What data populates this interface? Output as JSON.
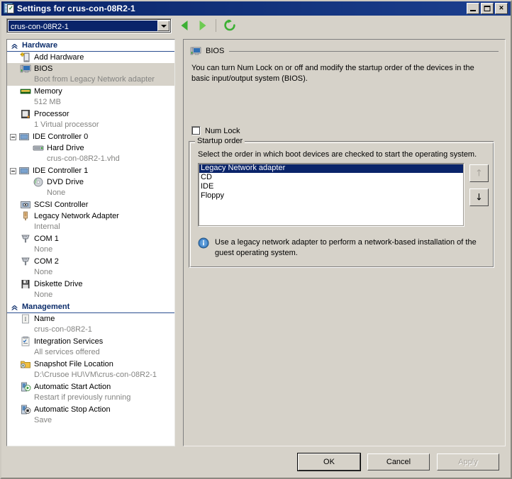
{
  "window": {
    "title": "Settings for crus-con-08R2-1",
    "title_icon": "settings-document-icon",
    "minimize_label": "",
    "maximize_label": "",
    "close_label": "×"
  },
  "toolbar": {
    "vm_selector_value": "crus-con-08R2-1",
    "back_icon": "back-arrow-icon",
    "forward_icon": "forward-arrow-icon",
    "refresh_icon": "refresh-icon"
  },
  "sidebar": {
    "groups": [
      {
        "title": "Hardware",
        "collapse_icon": "chevron-double-up-icon",
        "items": [
          {
            "label": "Add Hardware",
            "sub": "",
            "icon": "add-hardware-icon",
            "indent": 0,
            "expander": false,
            "selected": false
          },
          {
            "label": "BIOS",
            "sub": "Boot from Legacy Network adapter",
            "icon": "bios-icon",
            "indent": 0,
            "expander": false,
            "selected": true
          },
          {
            "label": "Memory",
            "sub": "512 MB",
            "icon": "memory-icon",
            "indent": 0,
            "expander": false,
            "selected": false
          },
          {
            "label": "Processor",
            "sub": "1 Virtual processor",
            "icon": "processor-icon",
            "indent": 0,
            "expander": false,
            "selected": false
          },
          {
            "label": "IDE Controller 0",
            "sub": "",
            "icon": "ide-controller-icon",
            "indent": 0,
            "expander": true,
            "selected": false
          },
          {
            "label": "Hard Drive",
            "sub": "crus-con-08R2-1.vhd",
            "icon": "hard-drive-icon",
            "indent": 1,
            "expander": false,
            "selected": false
          },
          {
            "label": "IDE Controller 1",
            "sub": "",
            "icon": "ide-controller-icon",
            "indent": 0,
            "expander": true,
            "selected": false
          },
          {
            "label": "DVD Drive",
            "sub": "None",
            "icon": "dvd-drive-icon",
            "indent": 1,
            "expander": false,
            "selected": false
          },
          {
            "label": "SCSI Controller",
            "sub": "",
            "icon": "scsi-controller-icon",
            "indent": 0,
            "expander": false,
            "selected": false
          },
          {
            "label": "Legacy Network Adapter",
            "sub": "Internal",
            "icon": "network-adapter-icon",
            "indent": 0,
            "expander": false,
            "selected": false
          },
          {
            "label": "COM 1",
            "sub": "None",
            "icon": "com-port-icon",
            "indent": 0,
            "expander": false,
            "selected": false
          },
          {
            "label": "COM 2",
            "sub": "None",
            "icon": "com-port-icon",
            "indent": 0,
            "expander": false,
            "selected": false
          },
          {
            "label": "Diskette Drive",
            "sub": "None",
            "icon": "diskette-drive-icon",
            "indent": 0,
            "expander": false,
            "selected": false
          }
        ]
      },
      {
        "title": "Management",
        "collapse_icon": "chevron-double-up-icon",
        "items": [
          {
            "label": "Name",
            "sub": "crus-con-08R2-1",
            "icon": "name-icon",
            "indent": 0,
            "expander": false,
            "selected": false
          },
          {
            "label": "Integration Services",
            "sub": "All services offered",
            "icon": "integration-services-icon",
            "indent": 0,
            "expander": false,
            "selected": false
          },
          {
            "label": "Snapshot File Location",
            "sub": "D:\\Crusoe HU\\VM\\crus-con-08R2-1",
            "icon": "snapshot-folder-icon",
            "indent": 0,
            "expander": false,
            "selected": false
          },
          {
            "label": "Automatic Start Action",
            "sub": "Restart if previously running",
            "icon": "start-action-icon",
            "indent": 0,
            "expander": false,
            "selected": false
          },
          {
            "label": "Automatic Stop Action",
            "sub": "Save",
            "icon": "stop-action-icon",
            "indent": 0,
            "expander": false,
            "selected": false
          }
        ]
      }
    ]
  },
  "main": {
    "header_title": "BIOS",
    "header_icon": "bios-icon",
    "description": "You can turn Num Lock on or off and modify the startup order of the devices in the basic input/output system (BIOS).",
    "num_lock": {
      "label": "Num Lock",
      "checked": false
    },
    "startup_order": {
      "legend": "Startup order",
      "hint": "Select the order in which boot devices are checked to start the operating system.",
      "devices": [
        {
          "label": "Legacy Network adapter",
          "selected": true
        },
        {
          "label": "CD",
          "selected": false
        },
        {
          "label": "IDE",
          "selected": false
        },
        {
          "label": "Floppy",
          "selected": false
        }
      ],
      "move_up_label": "↑",
      "move_down_label": "↓",
      "move_up_enabled": false,
      "move_down_enabled": true,
      "info_icon": "info-icon",
      "info_text": "Use a legacy network adapter to perform a network-based installation of the guest operating system."
    }
  },
  "footer": {
    "ok_label": "OK",
    "cancel_label": "Cancel",
    "apply_label": "Apply",
    "apply_enabled": false
  },
  "colors": {
    "titlebar_start": "#0a246a",
    "titlebar_end": "#1c3f8f",
    "dialog_face": "#d6d2c9",
    "group_title": "#0c2d6b",
    "selection": "#0a246a",
    "sub_text": "#848482",
    "nav_green": "#3cb034"
  }
}
